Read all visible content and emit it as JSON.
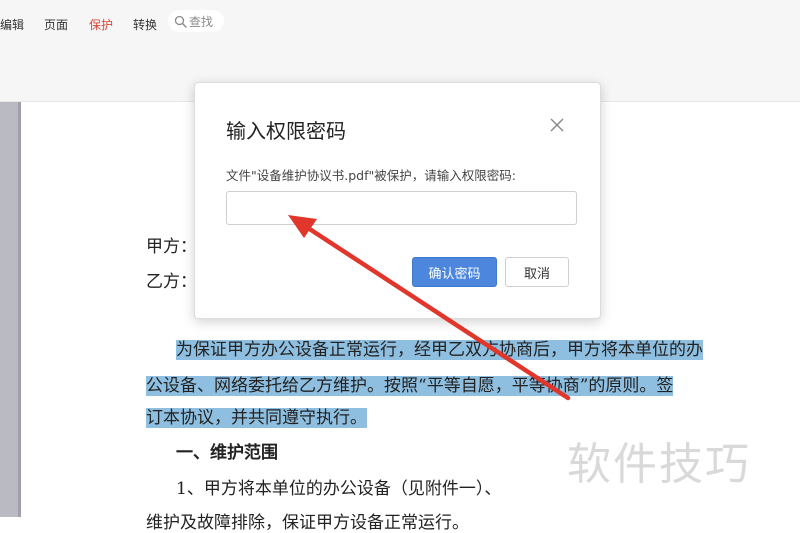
{
  "toolbar": {
    "tabs": [
      {
        "label": "编辑",
        "active": false
      },
      {
        "label": "页面",
        "active": false
      },
      {
        "label": "保护",
        "active": true
      },
      {
        "label": "转换",
        "active": false
      }
    ],
    "search_label": "查找",
    "active_color": "#d8473b"
  },
  "document": {
    "party_a": "甲方：",
    "party_b": "乙方：",
    "para1_line1": "为保证甲方办公设备正常运行，经甲乙双方协商后，甲方将本单位的办",
    "para1_line2": "公设备、网络委托给乙方维护。按照“平等自愿，平等协商”的原则。签",
    "para1_line3": "订本协议，并共同遵守执行。",
    "heading1": "一、维护范围",
    "para2_line1": "1、甲方将本单位的办公设备（见附件一）、",
    "para2_line2": "维护及故障排除，保证甲方设备正常运行。",
    "highlight_color": "#8fbfe0"
  },
  "dialog": {
    "title": "输入权限密码",
    "message": "文件\"设备维护协议书.pdf\"被保护，请输入权限密码:",
    "password_value": "",
    "confirm_label": "确认密码",
    "cancel_label": "取消",
    "primary_color": "#4c87dd"
  },
  "annotation": {
    "arrow_color": "#e0362c"
  },
  "watermark": {
    "text": "软件技巧"
  }
}
